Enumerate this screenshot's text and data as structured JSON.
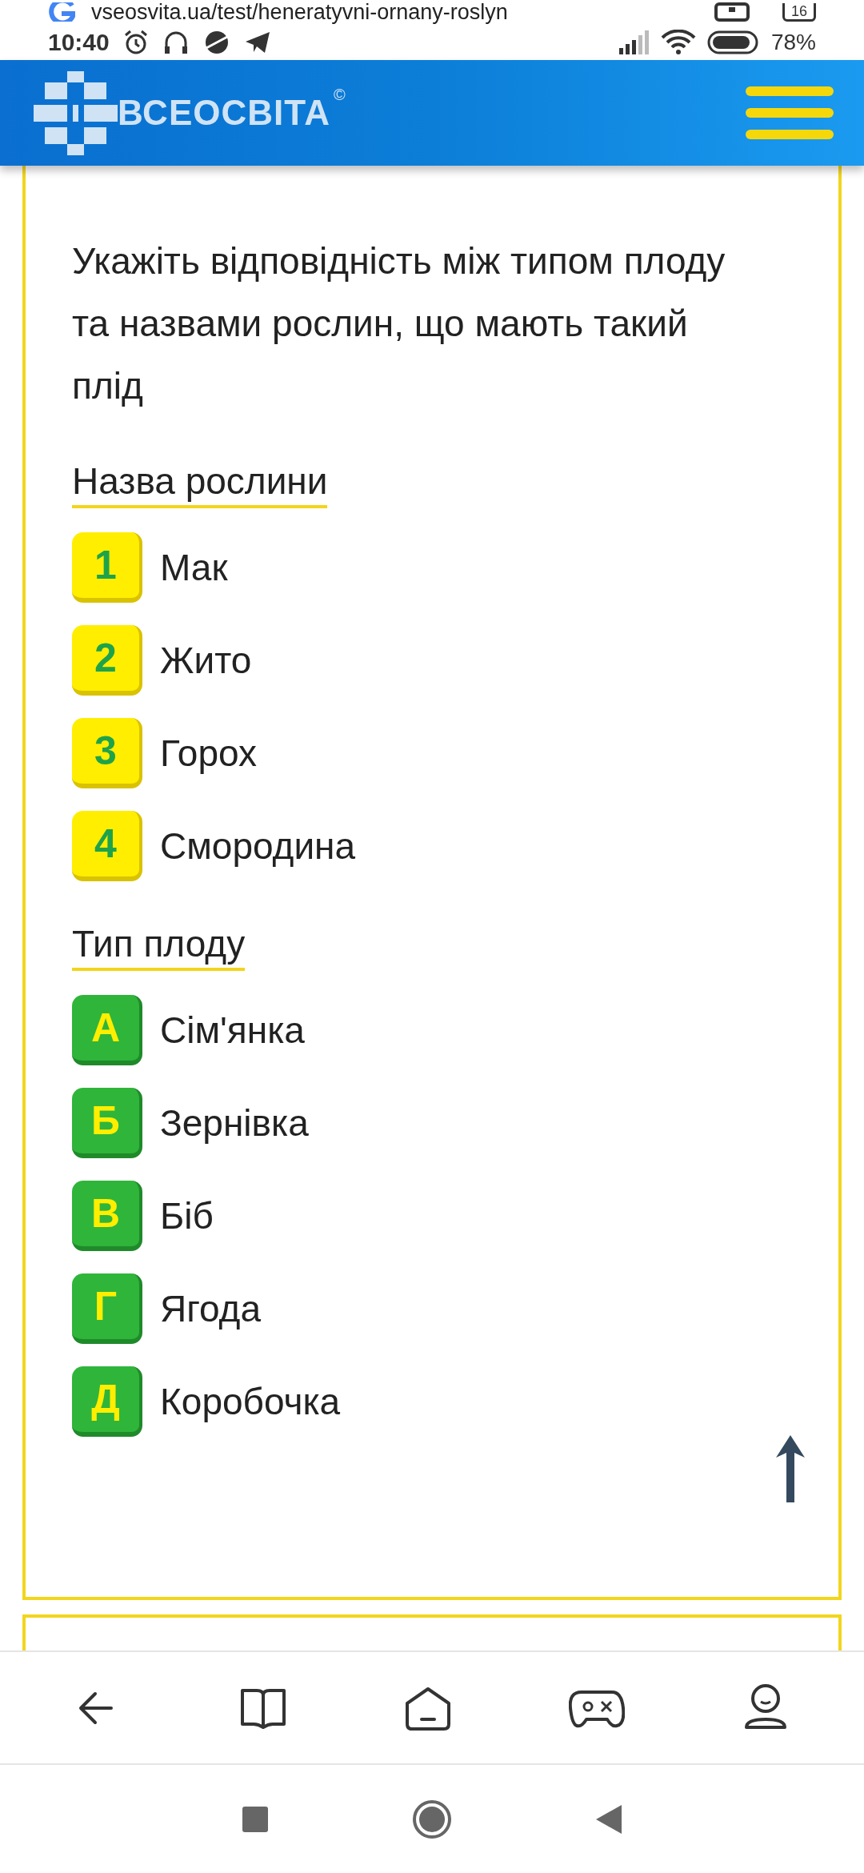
{
  "browser": {
    "url": "vseosvita.ua/test/heneratyvni-ornany-roslyn",
    "tab_count": "16"
  },
  "status_bar": {
    "time": "10:40",
    "battery": "78%"
  },
  "header": {
    "logo": "ВСЕОСВІТА",
    "logo_mark": "©"
  },
  "question": {
    "text": "Укажіть відповідність між типом плоду та назвами рослин, що мають такий плід",
    "groups": [
      {
        "title": "Назва рослини",
        "kind": "number",
        "items": [
          {
            "badge": "1",
            "label": "Мак"
          },
          {
            "badge": "2",
            "label": "Жито"
          },
          {
            "badge": "3",
            "label": "Горох"
          },
          {
            "badge": "4",
            "label": "Смородина"
          }
        ]
      },
      {
        "title": "Тип плоду",
        "kind": "letter",
        "items": [
          {
            "badge": "А",
            "label": "Сім'янка"
          },
          {
            "badge": "Б",
            "label": "Зернівка"
          },
          {
            "badge": "В",
            "label": "Біб"
          },
          {
            "badge": "Г",
            "label": "Ягода"
          },
          {
            "badge": "Д",
            "label": "Коробочка"
          }
        ]
      }
    ]
  }
}
